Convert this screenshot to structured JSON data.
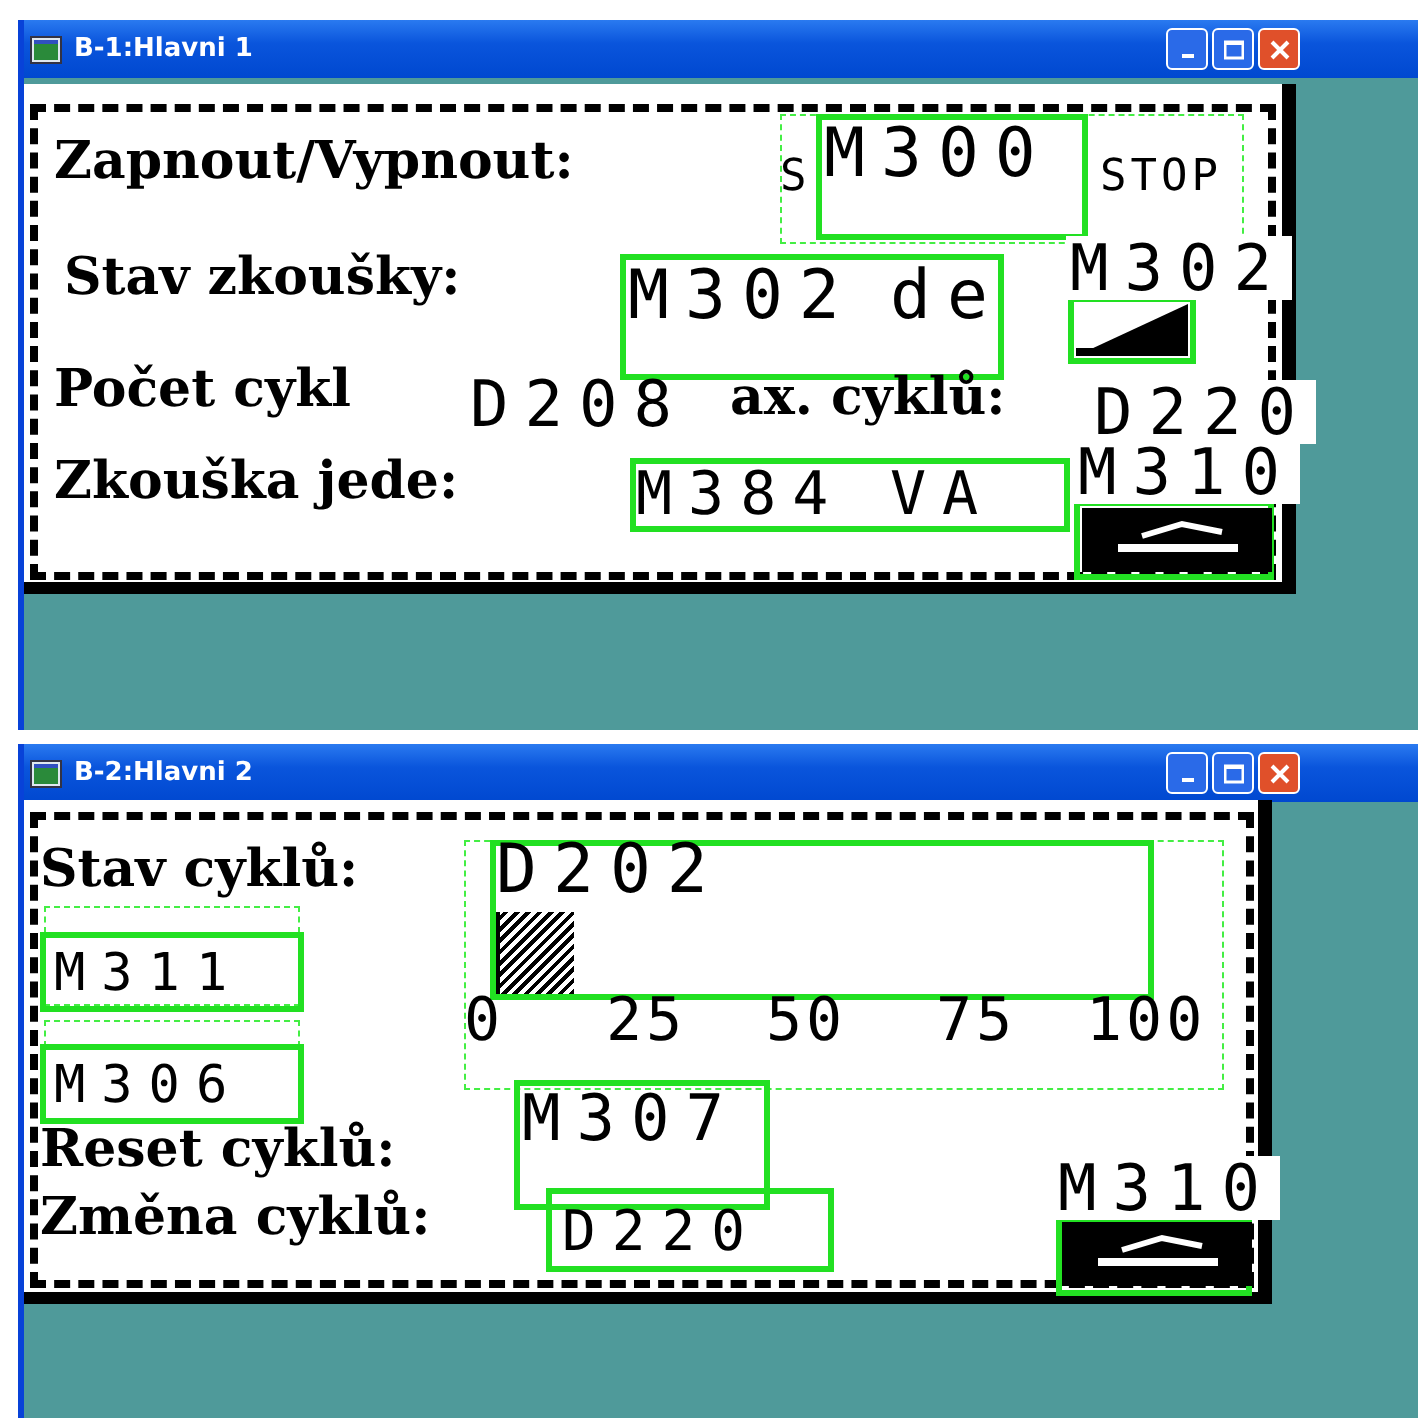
{
  "windows": [
    {
      "title": "B-1:Hlavni 1",
      "labels": [
        "Zapnout/Vypnout:",
        "Stav zkoušky:",
        "Počet cykl",
        "ax. cyklů:",
        "Zkouška jede:"
      ],
      "tags": [
        "M300",
        "S",
        "STOP",
        "M302",
        "de",
        "D208",
        "D220",
        "M384",
        "VA",
        "M302",
        "M310"
      ]
    },
    {
      "title": "B-2:Hlavni 2",
      "labels": [
        "Stav cyklů:",
        "Reset cyklů:",
        "Změna cyklů:"
      ],
      "tags": [
        "M311",
        "M306",
        "M307",
        "D220",
        "M310"
      ],
      "bargraph": {
        "tag": "D202",
        "level": 0.12,
        "ticks": [
          "0",
          "25",
          "50",
          "75",
          "100"
        ]
      }
    }
  ]
}
